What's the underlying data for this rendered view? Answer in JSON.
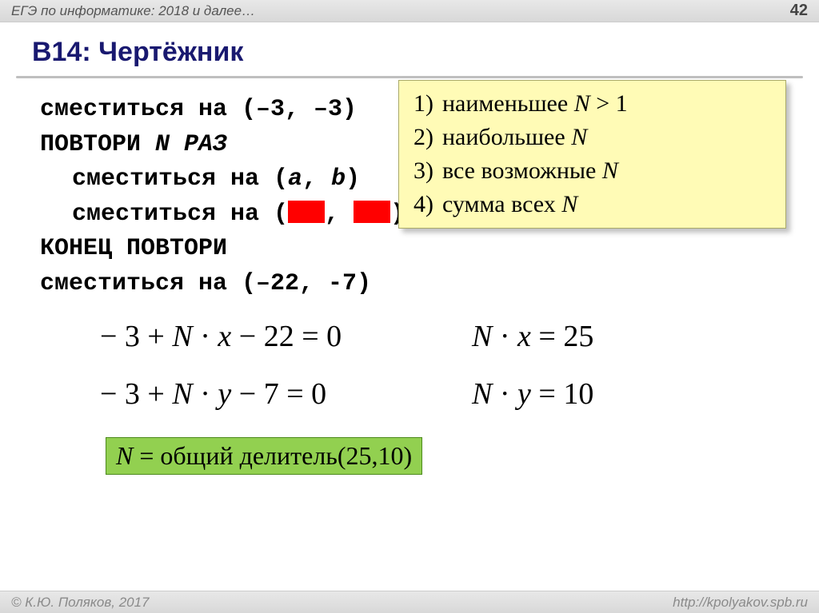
{
  "header": {
    "left": "ЕГЭ по информатике: 2018 и далее…",
    "page": "42"
  },
  "title": "B14: Чертёжник",
  "code": {
    "l1": "сместиться на (–3, –3)",
    "l2a": "ПОВТОРИ ",
    "l2b": "N",
    "l2c": " РАЗ",
    "l3a": "сместиться на (",
    "l3b": "a",
    "l3c": ", ",
    "l3d": "b",
    "l3e": ")",
    "l4a": "сместиться на (",
    "l4b": ", ",
    "l4c": ")",
    "l5": "КОНЕЦ ПОВТОРИ",
    "l6": "сместиться на (–22, -7)"
  },
  "yellow": {
    "items": [
      {
        "num": "1)",
        "pre": "наименьшее ",
        "n": "N",
        "post": " > 1"
      },
      {
        "num": "2)",
        "pre": "наибольшее ",
        "n": "N",
        "post": ""
      },
      {
        "num": "3)",
        "pre": "все возможные ",
        "n": "N",
        "post": ""
      },
      {
        "num": "4)",
        "pre": "сумма всех ",
        "n": "N",
        "post": ""
      }
    ]
  },
  "equations": {
    "e1": "− 3 + N · x − 22 = 0",
    "e2": "N · x = 25",
    "e3": "− 3 + N · y − 7 = 0",
    "e4": "N · y = 10"
  },
  "green": {
    "n": "N",
    "rest": " = общий делитель(25,10)"
  },
  "footer": {
    "left": "© К.Ю. Поляков, 2017",
    "right": "http://kpolyakov.spb.ru"
  }
}
